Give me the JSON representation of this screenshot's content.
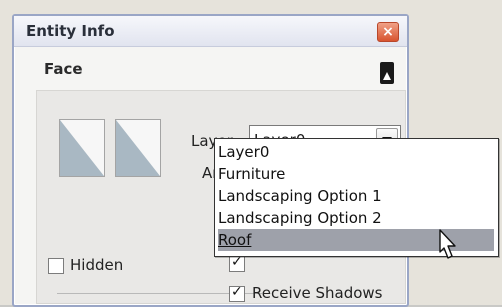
{
  "window": {
    "title": "Entity Info"
  },
  "section": {
    "title": "Face"
  },
  "fields": {
    "layer_label": "Layer:",
    "layer_value": "Layer0",
    "area_label": "Area:"
  },
  "dropdown": {
    "options": [
      "Layer0",
      "Furniture",
      "Landscaping Option 1",
      "Landscaping Option 2",
      "Roof"
    ],
    "selected": "Roof"
  },
  "checkboxes": {
    "hidden": {
      "label": "Hidden",
      "checked": false
    },
    "cast_shadows": {
      "checked": true
    },
    "receive_shadows": {
      "label": "Receive Shadows",
      "checked": true
    }
  },
  "colors": {
    "title_bar": "#e1e4ef",
    "close_button": "#d8542f",
    "selected_option": "#9ea1aa"
  },
  "icons": [
    "close-icon",
    "collapse-icon",
    "chevron-down-icon",
    "pointer-cursor-icon"
  ]
}
